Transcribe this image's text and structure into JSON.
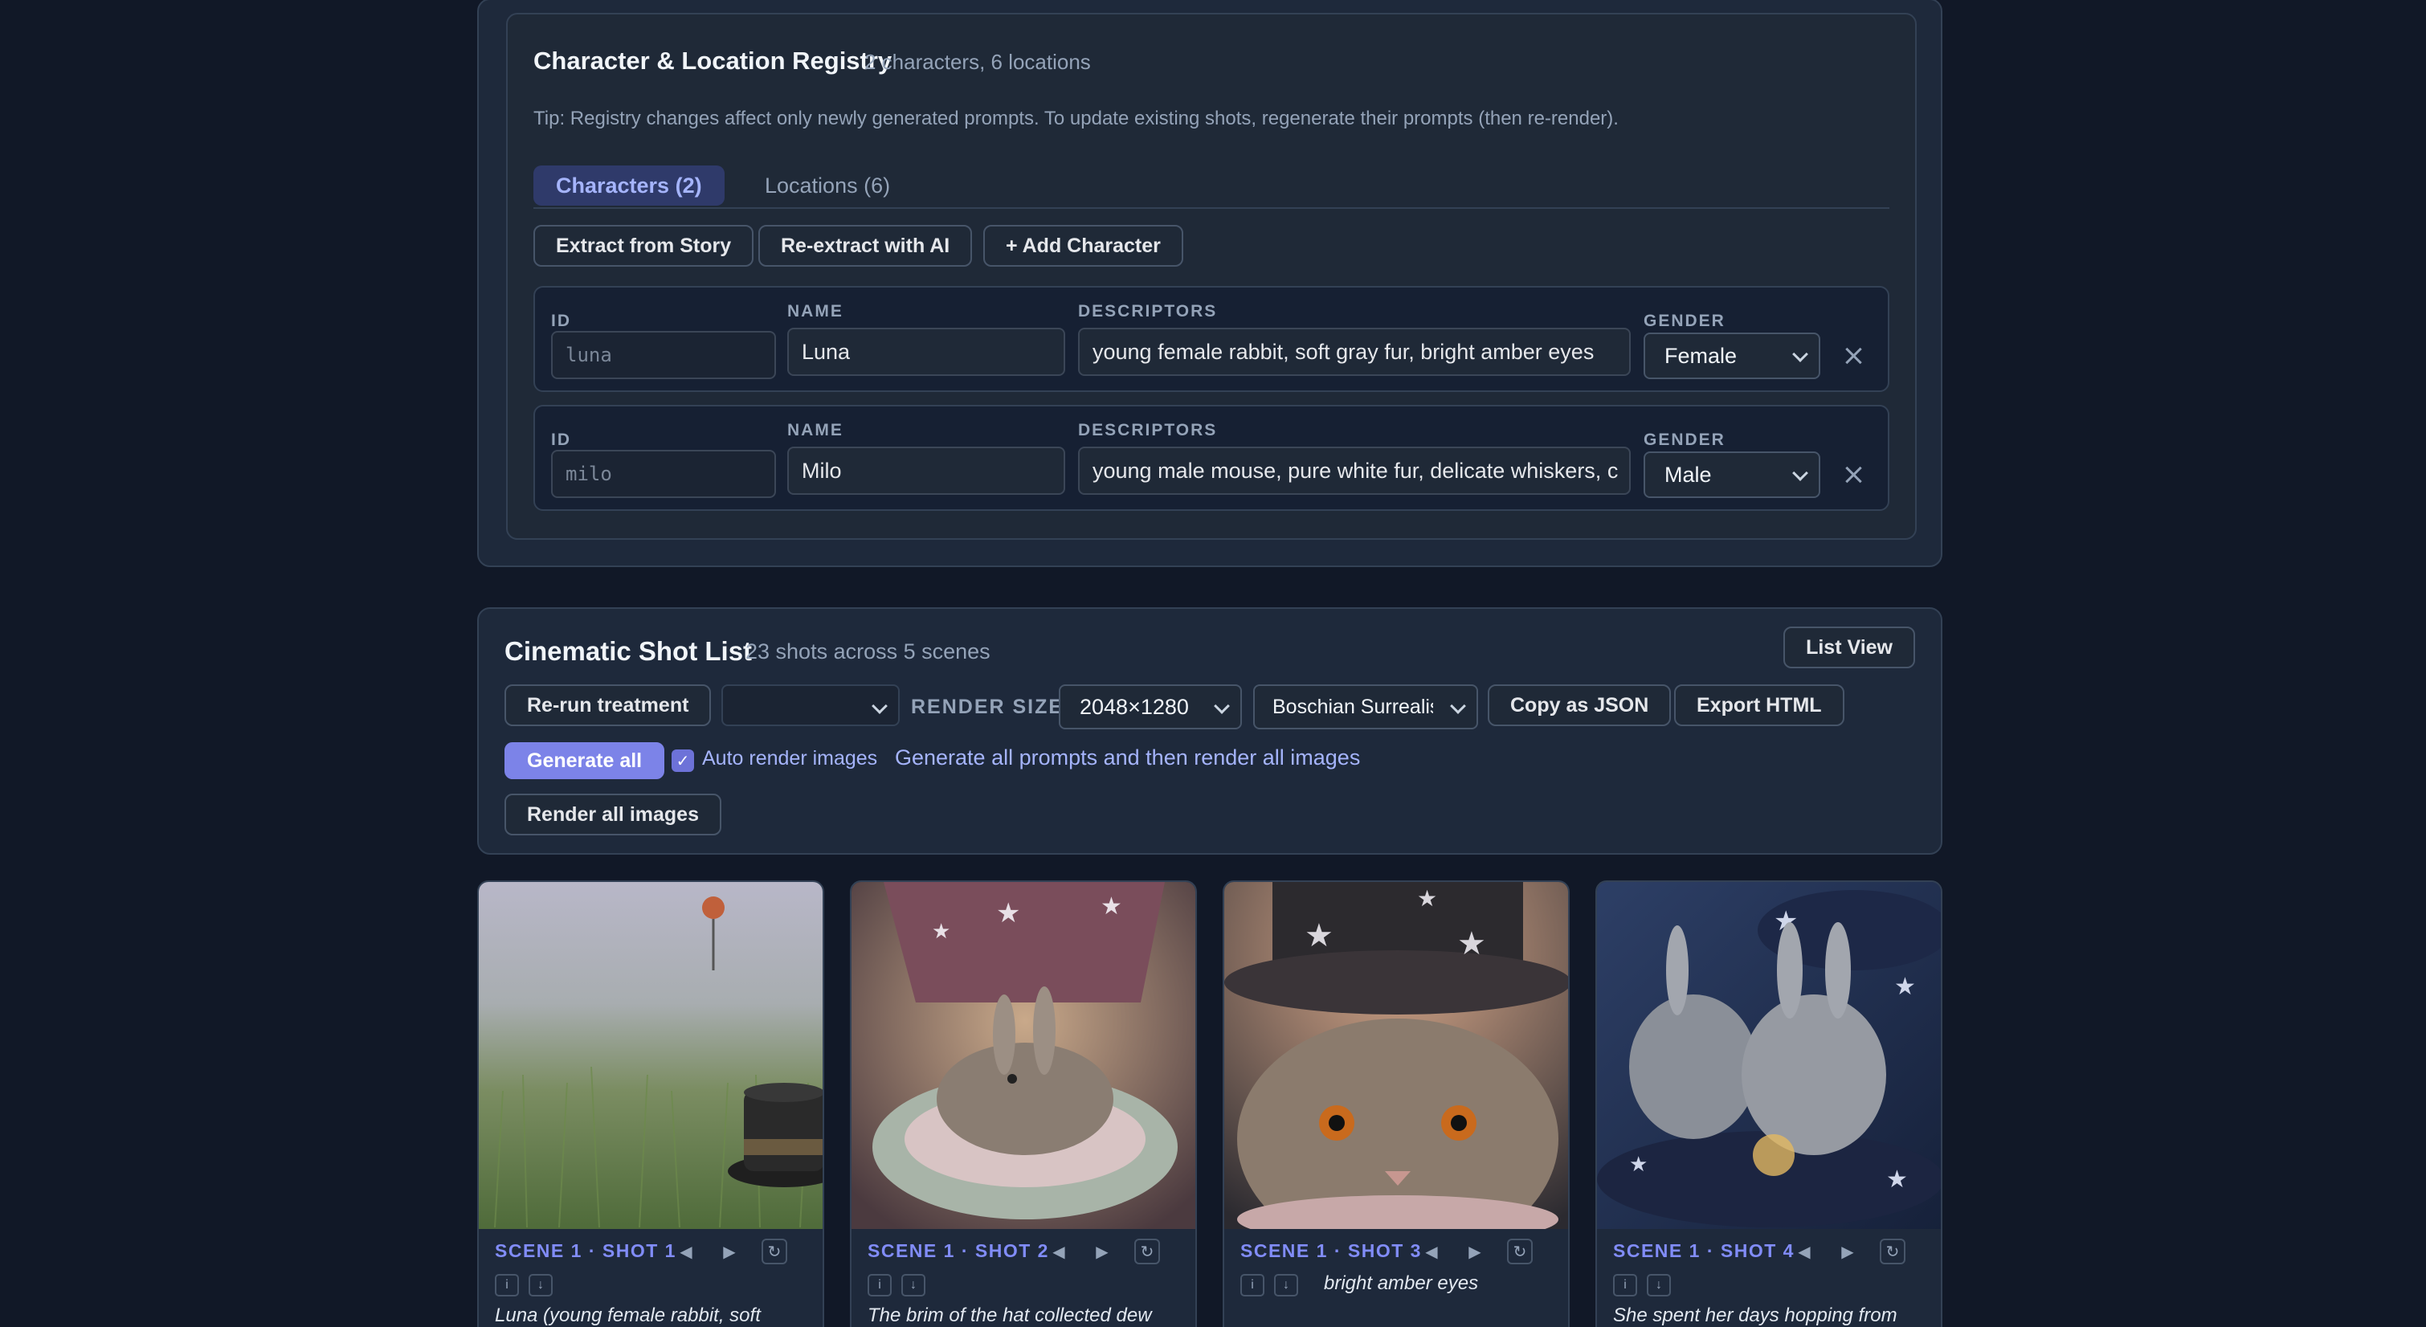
{
  "registry": {
    "title": "Character & Location Registry",
    "subtitle": "2 characters, 6 locations",
    "tip": "Tip: Registry changes affect only newly generated prompts. To update existing shots, regenerate their prompts (then re-render).",
    "tabs": {
      "characters": "Characters (2)",
      "locations": "Locations (6)"
    },
    "actions": {
      "extract": "Extract from Story",
      "reextract": "Re-extract with AI",
      "add": "+ Add Character"
    },
    "labels": {
      "id": "ID",
      "name": "NAME",
      "descriptors": "DESCRIPTORS",
      "gender": "GENDER"
    },
    "characters": [
      {
        "id": "luna",
        "name": "Luna",
        "descriptors": "young female rabbit, soft gray fur, bright amber eyes",
        "gender": "Female"
      },
      {
        "id": "milo",
        "name": "Milo",
        "descriptors": "young male mouse, pure white fur, delicate whiskers, c",
        "gender": "Male"
      }
    ]
  },
  "shotlist": {
    "title": "Cinematic Shot List",
    "subtitle": "23 shots across 5 scenes",
    "list_view": "List View",
    "rerun": "Re-run treatment",
    "render_size_label": "RENDER SIZE",
    "render_size": "2048×1280",
    "style": "Boschian Surrealism",
    "copy_json": "Copy as JSON",
    "export_html": "Export HTML",
    "generate_all": "Generate all",
    "auto_render": "Auto render images",
    "generate_all_link": "Generate all prompts and then render all images",
    "render_all": "Render all images"
  },
  "shots": [
    {
      "label": "SCENE 1 · SHOT 1",
      "caption": "Luna (young female rabbit, soft"
    },
    {
      "label": "SCENE 1 · SHOT 2",
      "caption": "The brim of the hat collected dew"
    },
    {
      "label": "SCENE 1 · SHOT 3",
      "caption": "bright amber eyes"
    },
    {
      "label": "SCENE 1 · SHOT 4",
      "caption": "She spent her days hopping from"
    }
  ],
  "colors": {
    "background": "#111827",
    "panel": "#1e293b",
    "accent": "#818cf8",
    "primary_button": "#7c83e8"
  },
  "icons": {
    "prev": "triangle-left-icon",
    "next": "triangle-right-icon",
    "regen": "refresh-icon",
    "info": "info-icon",
    "download": "download-icon",
    "remove": "close-icon"
  }
}
